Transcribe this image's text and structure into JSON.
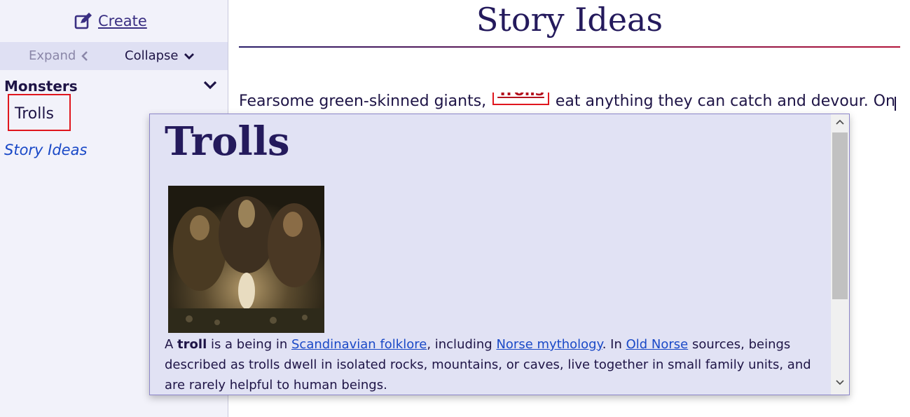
{
  "sidebar": {
    "create_label": "Create",
    "expand_label": "Expand",
    "collapse_label": "Collapse",
    "section_title": "Monsters",
    "items": [
      {
        "label": "Trolls"
      },
      {
        "label": "Story Ideas"
      }
    ]
  },
  "main": {
    "title": "Story Ideas",
    "text_before": "Fearsome green-skinned giants, ",
    "link_label": "Trolls",
    "text_after": " eat anything they can catch and devour. Only acid"
  },
  "popup": {
    "title": "Trolls",
    "para": {
      "p1": "A ",
      "bold": "troll",
      "p2": " is a being in ",
      "link1": "Scandinavian folklore",
      "p3": ", including ",
      "link2": "Norse mythology",
      "p4": ". In ",
      "link3": "Old Norse",
      "p5": " sources, beings described as trolls dwell in isolated rocks, mountains, or caves, live together in small family units, and are rarely helpful to human beings."
    }
  },
  "icons": {
    "create": "edit-icon",
    "expand": "chevron-left-icon",
    "collapse": "chevron-down-icon",
    "section": "chevron-down-icon",
    "scroll_up": "chevron-up-icon",
    "scroll_down": "chevron-down-icon"
  },
  "colors": {
    "accent": "#3a2f82",
    "highlight_border": "#e0161e",
    "link": "#1a49c7",
    "popup_bg": "#e1e2f4"
  }
}
